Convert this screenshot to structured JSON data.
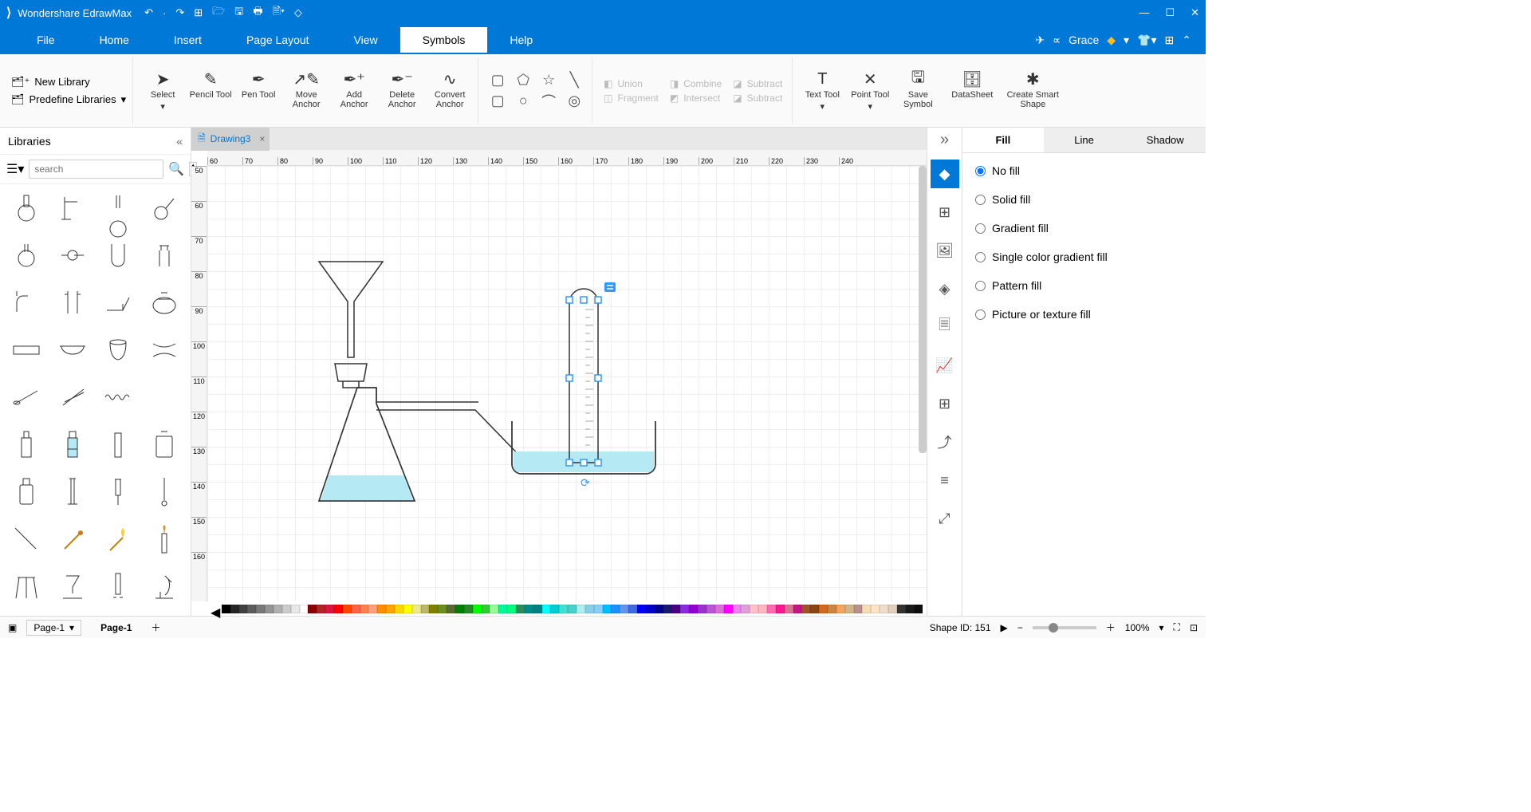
{
  "app": {
    "name": "Wondershare EdrawMax"
  },
  "menu": {
    "items": [
      "File",
      "Home",
      "Insert",
      "Page Layout",
      "View",
      "Symbols",
      "Help"
    ],
    "active": "Symbols",
    "user": "Grace"
  },
  "ribbon": {
    "new_library": "New Library",
    "predefine_libraries": "Predefine Libraries",
    "tools": {
      "select": "Select",
      "pencil": "Pencil Tool",
      "pen": "Pen Tool",
      "move_anchor": "Move Anchor",
      "add_anchor": "Add Anchor",
      "delete_anchor": "Delete Anchor",
      "convert_anchor": "Convert Anchor",
      "text_tool": "Text Tool",
      "point_tool": "Point Tool",
      "save_symbol": "Save Symbol",
      "datasheet": "DataSheet",
      "create_smart": "Create Smart Shape"
    },
    "bool_ops": {
      "union": "Union",
      "combine": "Combine",
      "subtract": "Subtract",
      "fragment": "Fragment",
      "intersect": "Intersect",
      "subtract2": "Subtract"
    }
  },
  "lib_panel": {
    "title": "Libraries",
    "search_placeholder": "search"
  },
  "doc_tab": "Drawing3",
  "ruler_h": [
    "60",
    "70",
    "80",
    "90",
    "100",
    "110",
    "120",
    "130",
    "140",
    "150",
    "160",
    "170",
    "180",
    "190",
    "200",
    "210",
    "220",
    "230",
    "240"
  ],
  "ruler_v": [
    "50",
    "60",
    "70",
    "80",
    "90",
    "100",
    "110",
    "120",
    "130",
    "140",
    "150",
    "160"
  ],
  "prop": {
    "tabs": [
      "Fill",
      "Line",
      "Shadow"
    ],
    "active": "Fill",
    "options": [
      "No fill",
      "Solid fill",
      "Gradient fill",
      "Single color gradient fill",
      "Pattern fill",
      "Picture or texture fill"
    ],
    "selected": "No fill"
  },
  "status": {
    "page_sel": "Page-1",
    "page_tab": "Page-1",
    "shape_id": "Shape ID: 151",
    "zoom": "100%"
  },
  "colors": [
    "#000000",
    "#252525",
    "#404040",
    "#5c5c5c",
    "#787878",
    "#949494",
    "#b0b0b0",
    "#cccccc",
    "#e8e8e8",
    "#ffffff",
    "#8b0000",
    "#b22222",
    "#dc143c",
    "#ff0000",
    "#ff4500",
    "#ff6347",
    "#ff7f50",
    "#ffa07a",
    "#ff8c00",
    "#ffa500",
    "#ffd700",
    "#ffff00",
    "#f0e68c",
    "#bdb76b",
    "#808000",
    "#6b8e23",
    "#556b2f",
    "#008000",
    "#228b22",
    "#00ff00",
    "#32cd32",
    "#98fb98",
    "#00fa9a",
    "#00ff7f",
    "#2e8b57",
    "#008b8b",
    "#008080",
    "#00ffff",
    "#00ced1",
    "#40e0d0",
    "#48d1cc",
    "#afeeee",
    "#87ceeb",
    "#87cefa",
    "#00bfff",
    "#1e90ff",
    "#6495ed",
    "#4169e1",
    "#0000ff",
    "#0000cd",
    "#00008b",
    "#191970",
    "#4b0082",
    "#8a2be2",
    "#9400d3",
    "#9932cc",
    "#ba55d3",
    "#da70d6",
    "#ff00ff",
    "#ee82ee",
    "#dda0dd",
    "#ffc0cb",
    "#ffb6c1",
    "#ff69b4",
    "#ff1493",
    "#db7093",
    "#c71585",
    "#a0522d",
    "#8b4513",
    "#d2691e",
    "#cd853f",
    "#f4a460",
    "#d2b48c",
    "#bc8f8f",
    "#f5deb3",
    "#ffe4c4",
    "#eeddcc",
    "#e0d0bb",
    "#333333",
    "#1a1a1a",
    "#0d0d0d"
  ]
}
